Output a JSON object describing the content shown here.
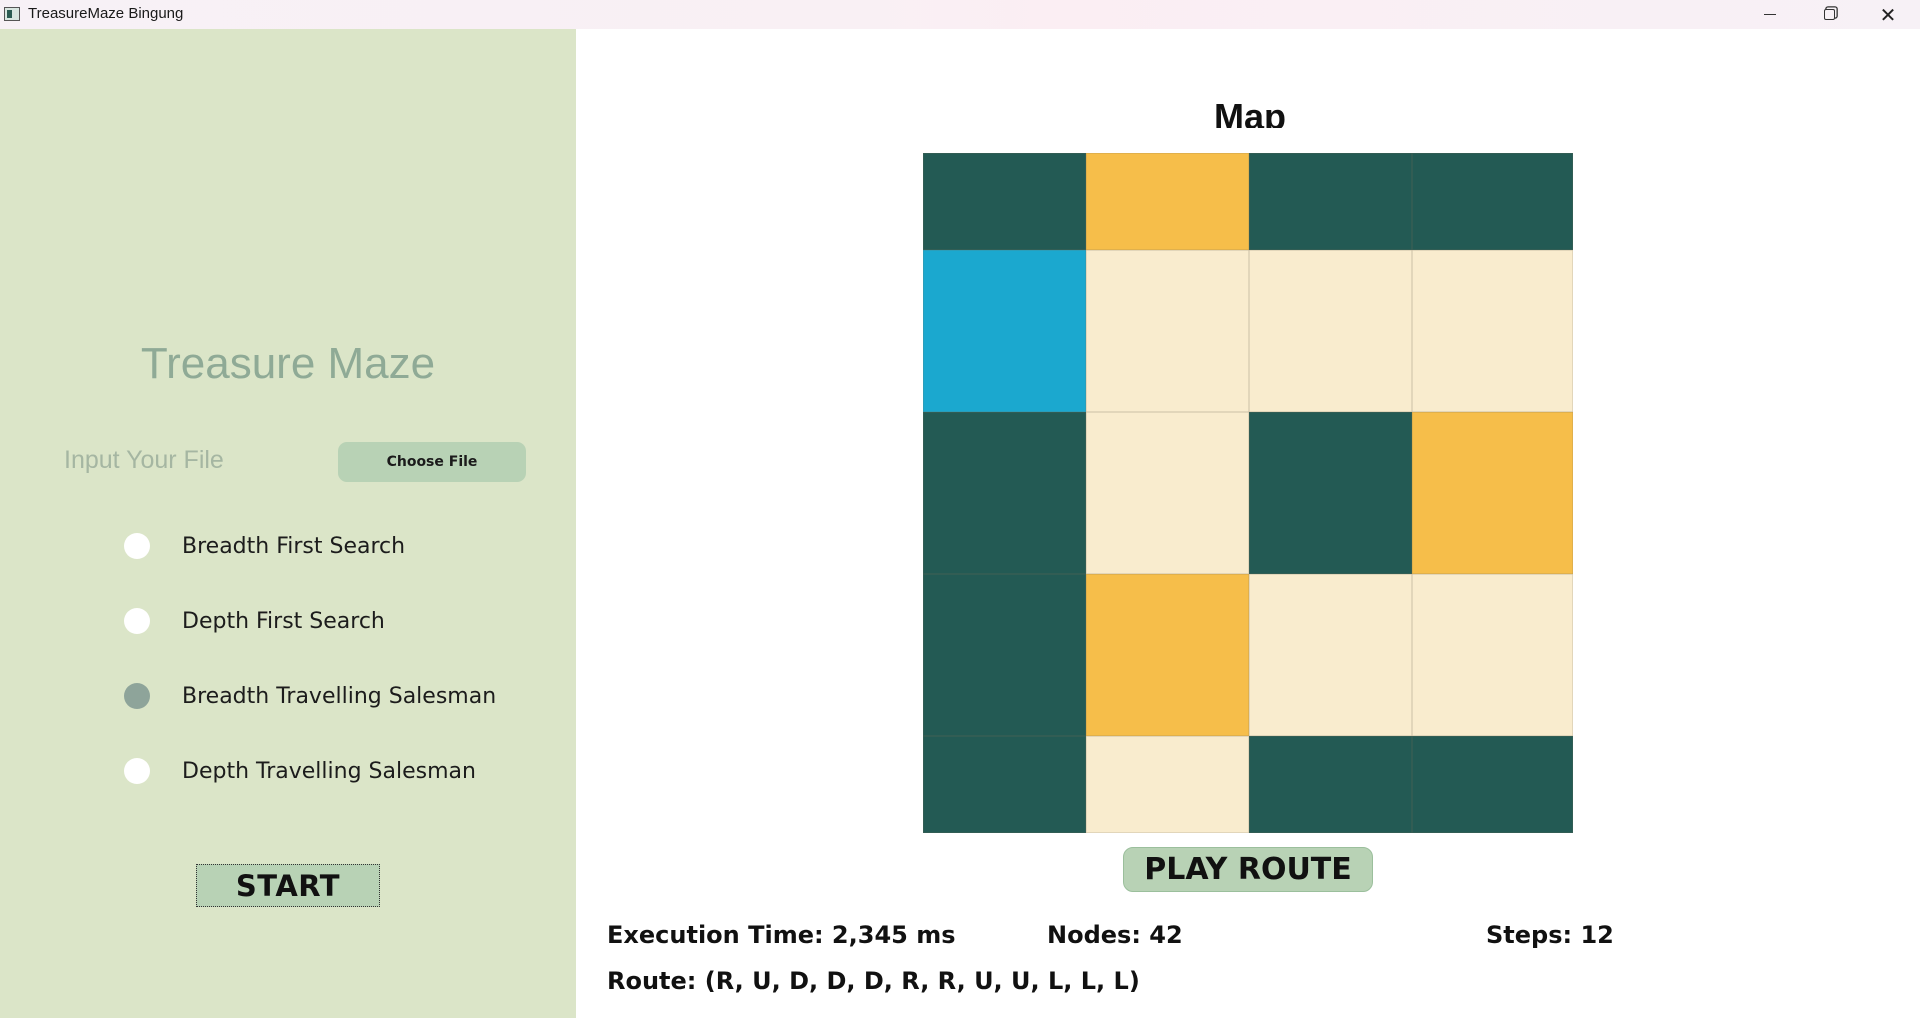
{
  "window": {
    "title": "TreasureMaze Bingung",
    "minimize_icon": "minimize-icon",
    "maximize_icon": "restore-icon",
    "close_glyph": "✕"
  },
  "sidebar": {
    "app_title": "Treasure Maze",
    "input_label": "Input Your File",
    "choose_file_label": "Choose File",
    "algorithms": [
      {
        "label": "Breadth First Search",
        "selected": false
      },
      {
        "label": "Depth First Search",
        "selected": false
      },
      {
        "label": "Breadth Travelling Salesman",
        "selected": true
      },
      {
        "label": "Depth Travelling Salesman",
        "selected": false
      }
    ],
    "start_label": "START"
  },
  "map": {
    "title": "Map",
    "colors": {
      "wall": "#235a54",
      "path": "#f9ecce",
      "treasure": "#f6be4a",
      "start": "#1ba8cf"
    },
    "grid": [
      [
        "wall",
        "treasure",
        "wall",
        "wall"
      ],
      [
        "start",
        "path",
        "path",
        "path"
      ],
      [
        "wall",
        "path",
        "wall",
        "treasure"
      ],
      [
        "wall",
        "treasure",
        "path",
        "path"
      ],
      [
        "wall",
        "path",
        "wall",
        "wall"
      ]
    ],
    "play_route_label": "PLAY ROUTE"
  },
  "results": {
    "execution_time": "Execution Time: 2,345 ms",
    "nodes": "Nodes: 42",
    "steps": "Steps: 12",
    "route": "Route: (R, U, D, D, D, R, R, U, U, L, L, L)"
  }
}
